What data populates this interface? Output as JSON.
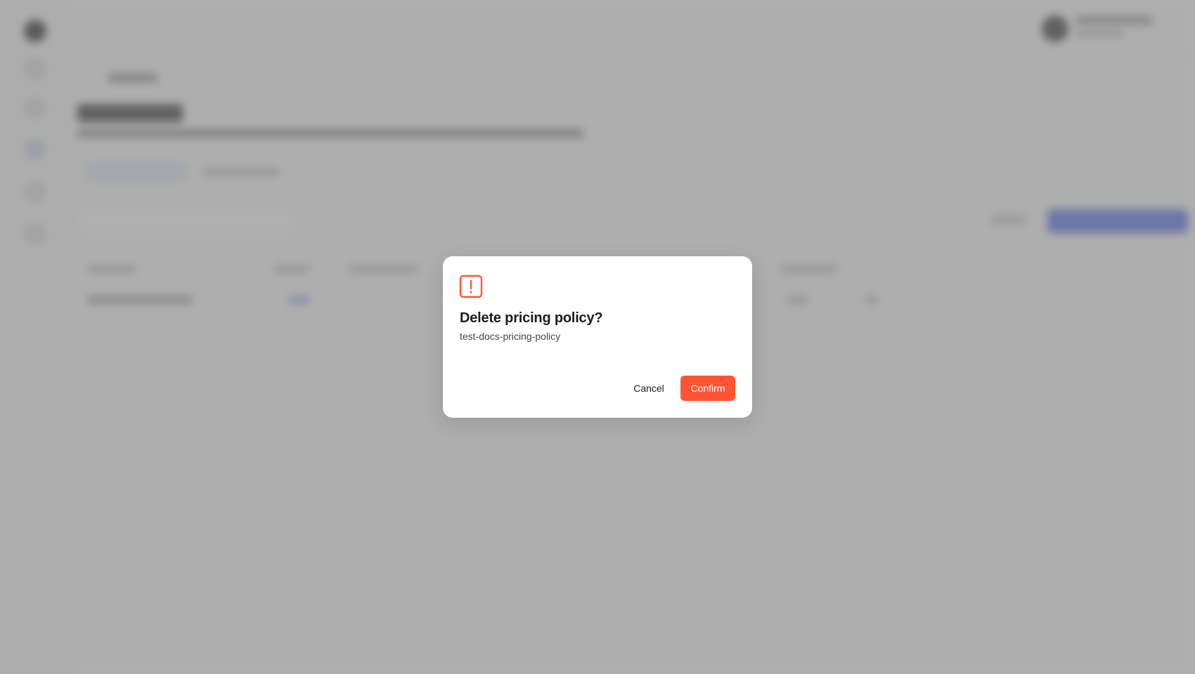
{
  "dialog": {
    "icon": "alert-square-icon",
    "title": "Delete pricing policy?",
    "subtitle": "test-docs-pricing-policy",
    "cancel_label": "Cancel",
    "confirm_label": "Confirm"
  },
  "colors": {
    "danger": "#FF5533",
    "overlay": "#808080",
    "accent": "#4C67EA"
  }
}
